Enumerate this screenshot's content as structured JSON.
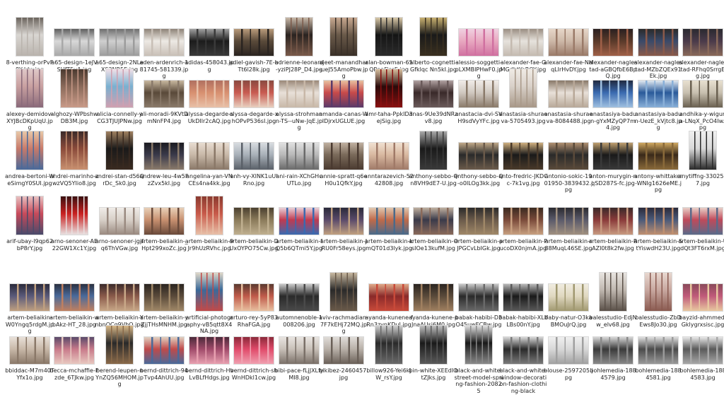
{
  "files": [
    {
      "name": "8-verthing-orPvF8Y-Idw.jpg",
      "shape": "p",
      "colors": [
        "#d9d6d2",
        "#b9b3ad",
        "#6a635c"
      ]
    },
    {
      "name": "a65-design-1eJVSUfT5yA.jpg",
      "shape": "l",
      "colors": [
        "#d8d8d8",
        "#a8a8a8",
        "#5e5e5e"
      ]
    },
    {
      "name": "a65-design-2NLeXS3NR5E.jpg",
      "shape": "l",
      "colors": [
        "#cfcfcf",
        "#9c9c9c",
        "#6e6e6e"
      ]
    },
    {
      "name": "aden-ardenrich-181745-581339.jpg",
      "shape": "l",
      "colors": [
        "#ede9e4",
        "#c8bfb6",
        "#8e8378"
      ]
    },
    {
      "name": "adidas-458043.jpg",
      "shape": "l",
      "colors": [
        "#1c1c1c",
        "#3a3a3a",
        "#a0a0a0"
      ]
    },
    {
      "name": "adiel-gavish-7E-bTt6l28k.jpg",
      "shape": "l",
      "colors": [
        "#5a4a3a",
        "#2a2420",
        "#b89a7a"
      ]
    },
    {
      "name": "adrienne-leonard-yziPJ28P_D4.jpg",
      "shape": "p",
      "colors": [
        "#2a2320",
        "#7a5a4a",
        "#c8b8a8"
      ]
    },
    {
      "name": "ajeet-manandhar-ueJ55AmoPbw.jpg",
      "shape": "p",
      "colors": [
        "#6a5a4a",
        "#3a3028",
        "#c8a890"
      ]
    },
    {
      "name": "alan-bowman-65QPpnFissE.jpg",
      "shape": "p",
      "colors": [
        "#141414",
        "#2c2c2c",
        "#d8c8a8"
      ]
    },
    {
      "name": "alberto-cognetti-Gfklqc Nn5kI.jpg",
      "shape": "p",
      "colors": [
        "#1a1a1a",
        "#3a3020",
        "#c8b070"
      ]
    },
    {
      "name": "alessio-soggetti-pLXMBIPHwF0.jpg",
      "shape": "l",
      "colors": [
        "#e8a8c0",
        "#d070a0",
        "#f0d0e0"
      ]
    },
    {
      "name": "alexander-fae-GMGdhtYeROY.jpg",
      "shape": "l",
      "colors": [
        "#e6e2dc",
        "#c4bab0",
        "#9a8e82"
      ]
    },
    {
      "name": "alexander-fae-NHqLIrHvDY.jpg",
      "shape": "l",
      "colors": [
        "#cdb8a8",
        "#9a7a68",
        "#e6d6c8"
      ]
    },
    {
      "name": "alexander-naglestad-aGBQfbE6BpQ.jpg",
      "shape": "l",
      "colors": [
        "#5a3a2a",
        "#a06048",
        "#2a2020"
      ]
    },
    {
      "name": "alexander-naglestad-MZbZQEx91Ek.jpg",
      "shape": "l",
      "colors": [
        "#3a4a6a",
        "#8a5a4a",
        "#2a2a2a"
      ]
    },
    {
      "name": "alexander-naglestad-RFhq0SrrgEg.jpg",
      "shape": "l",
      "colors": [
        "#4a3a4a",
        "#8a6a5a",
        "#2a2a30"
      ]
    },
    {
      "name": "alexey-demidov-XYJBcDKpUqU.jpg",
      "shape": "p",
      "colors": [
        "#c8a0a0",
        "#8a6a7a",
        "#e0c8c8"
      ]
    },
    {
      "name": "alghozy-WPbshwDB3M.jpg",
      "shape": "p",
      "colors": [
        "#8a6a5a",
        "#c89a88",
        "#4a3a30"
      ]
    },
    {
      "name": "alicia-connelly-yCG3TJUJPNw.jpg",
      "shape": "p",
      "colors": [
        "#7ab0d0",
        "#d0a0b0",
        "#f0e0e8"
      ]
    },
    {
      "name": "ali-moradi-9KVtDmNnFP4.jpg",
      "shape": "l",
      "colors": [
        "#5a4a3a",
        "#8a7a6a",
        "#c8b8a0"
      ]
    },
    {
      "name": "alyssa-degarde-sUkDIlr2cAQ.jpg",
      "shape": "l",
      "colors": [
        "#d89070",
        "#e8c0a8",
        "#b07060"
      ]
    },
    {
      "name": "alyssa-degarde-xhOPvP536sI.jpg",
      "shape": "l",
      "colors": [
        "#c85a50",
        "#e8d0c0",
        "#8a4a40"
      ]
    },
    {
      "name": "alyssa-strohmann-TS--uNw-JqE.jpg",
      "shape": "l",
      "colors": [
        "#e8e0d8",
        "#c8b8a8",
        "#9a8878"
      ]
    },
    {
      "name": "amanda-canas-WIDjrxUGLUE.jpg",
      "shape": "l",
      "colors": [
        "#c84a4a",
        "#5a3a6a",
        "#e8c0a0"
      ]
    },
    {
      "name": "amr-taha-PpkID3ejSig.jpg",
      "shape": "p",
      "colors": [
        "#2a0a0a",
        "#8a1010",
        "#d8c0a0"
      ]
    },
    {
      "name": "anas-9Ue39dNRzv8.jpg",
      "shape": "l",
      "colors": [
        "#3a2a2a",
        "#6a5a5a",
        "#b0a0a0"
      ]
    },
    {
      "name": "anastacia-dvi-SVH9sdVyYFc.jpg",
      "shape": "l",
      "colors": [
        "#d0c8c0",
        "#8a7a6a",
        "#f0ece8"
      ]
    },
    {
      "name": "anastasia-shuraeva-5705493.jpg",
      "shape": "p",
      "colors": [
        "#d8d0c8",
        "#a89888",
        "#f0ebe5"
      ]
    },
    {
      "name": "anastasia-shuraeva-8084488.jpg",
      "shape": "l",
      "colors": [
        "#e8e0d8",
        "#b8a898",
        "#887868"
      ]
    },
    {
      "name": "anastasiya-badun-gYxMZyQP7m4.jpg",
      "shape": "l",
      "colors": [
        "#3a6ab0",
        "#a0c0e0",
        "#202a40"
      ]
    },
    {
      "name": "anastasiya-badun-UezE_kVjtc8.jpg",
      "shape": "l",
      "colors": [
        "#2a5a9a",
        "#8ab0d8",
        "#e0e8f0"
      ]
    },
    {
      "name": "andhika-y-wiguna-LNqX_PcO4Iw.jpg",
      "shape": "l",
      "colors": [
        "#c8c0b0",
        "#6a6050",
        "#e8e0d0"
      ]
    },
    {
      "name": "andrea-bertoni-WeSimgY0SUI.jpg",
      "shape": "p",
      "colors": [
        "#c87a6a",
        "#4a6a9a",
        "#e8c8a8"
      ]
    },
    {
      "name": "andrei-marinho-zwzVQ5YIio8.jpg",
      "shape": "p",
      "colors": [
        "#8a4a3a",
        "#c89070",
        "#3a2a2a"
      ]
    },
    {
      "name": "andrei-stan-d56QrDc_Sk0.jpg",
      "shape": "p",
      "colors": [
        "#1a1a1a",
        "#3a2a20",
        "#a08060"
      ]
    },
    {
      "name": "andrew-leu-4w5FzZvx5kI.jpg",
      "shape": "l",
      "colors": [
        "#3a3a4a",
        "#8a7a6a",
        "#1a1a20"
      ]
    },
    {
      "name": "angelina-yan-VNCEs4na4kk.jpg",
      "shape": "l",
      "colors": [
        "#c8b8a8",
        "#8a7868",
        "#e8dcd0"
      ]
    },
    {
      "name": "anh-vy-XINK1uUlRno.jpg",
      "shape": "l",
      "colors": [
        "#a8b0b8",
        "#5a6068",
        "#d8dce0"
      ]
    },
    {
      "name": "ani-rain-XChGHcUTLo.jpg",
      "shape": "l",
      "colors": [
        "#b8b8b8",
        "#6a6a6a",
        "#e0e0e0"
      ]
    },
    {
      "name": "annie-spratt-q6eH0u1QfkY.jpg",
      "shape": "l",
      "colors": [
        "#7a6a5a",
        "#4a3a30",
        "#c0b0a0"
      ]
    },
    {
      "name": "anntarazevich-5242808.jpg",
      "shape": "l",
      "colors": [
        "#d8b8a0",
        "#a07a68",
        "#f0e0d0"
      ]
    },
    {
      "name": "anthony-sebbo-Qn8VH9dE7-U.jpg",
      "shape": "p",
      "colors": [
        "#1a1a1a",
        "#3a3a3a",
        "#a8a8a8"
      ]
    },
    {
      "name": "anthony-sebbo-Q-o0ILOg3kk.jpg",
      "shape": "l",
      "colors": [
        "#2a2a2a",
        "#6a5a4a",
        "#c0a888"
      ]
    },
    {
      "name": "anto-fredric-JKDCc-7k1vg.jpg",
      "shape": "l",
      "colors": [
        "#1a1a1a",
        "#4a3a2a",
        "#d0b080"
      ]
    },
    {
      "name": "antonio-sokic-1901950-3839432.jpg",
      "shape": "l",
      "colors": [
        "#2a2a2a",
        "#5a4a3a",
        "#b09070"
      ]
    },
    {
      "name": "anton-murygin-nqSD287S-fc.jpg",
      "shape": "l",
      "colors": [
        "#1a1a1a",
        "#3a3a3a",
        "#c0a070"
      ]
    },
    {
      "name": "antony-whittaker-WNIg1626eME.jpg",
      "shape": "l",
      "colors": [
        "#3a2a1a",
        "#8a6a3a",
        "#d0a860"
      ]
    },
    {
      "name": "anytiffng-3302537.jpg",
      "shape": "p",
      "colors": [
        "#d8d8d8",
        "#2a2a2a",
        "#f0f0f0"
      ]
    },
    {
      "name": "arif-ubay-l9qp62bP8rY.jpg",
      "shape": "p",
      "colors": [
        "#c84a5a",
        "#4a4a6a",
        "#e8c0c0"
      ]
    },
    {
      "name": "arno-senoner-AE22GW1Xc1Y.jpg",
      "shape": "p",
      "colors": [
        "#c82020",
        "#e8e0e0",
        "#3a1010"
      ]
    },
    {
      "name": "arno-senoner-jgjfq6ThVGw.jpg",
      "shape": "l",
      "colors": [
        "#d8d0c8",
        "#9a8a80",
        "#f0ece8"
      ]
    },
    {
      "name": "artem-beliaikin-_Hpt299xoZc.jpg",
      "shape": "l",
      "colors": [
        "#c89070",
        "#6a4a3a",
        "#e8d0b8"
      ]
    },
    {
      "name": "artem-beliaikin-9Jr9hUzRVhc.jpg",
      "shape": "p",
      "colors": [
        "#c85a4a",
        "#e8c0a8",
        "#8a3a30"
      ]
    },
    {
      "name": "artem-beliaikin-DUxOYPO75Cw.jpg",
      "shape": "l",
      "colors": [
        "#8a7a5a",
        "#c0b090",
        "#4a4030"
      ]
    },
    {
      "name": "artem-beliaikin-fQ5b6QTmi5Y.jpg",
      "shape": "l",
      "colors": [
        "#c03a50",
        "#3a6ab0",
        "#e8d0d8"
      ]
    },
    {
      "name": "artem-beliaikin-JRU0Fr58eys.jpg",
      "shape": "l",
      "colors": [
        "#5a4a6a",
        "#c0a080",
        "#2a2a3a"
      ]
    },
    {
      "name": "artem-beliaikin-kmQT01d3lyk.jpg",
      "shape": "l",
      "colors": [
        "#c06a4a",
        "#4a6a8a",
        "#e0c8b0"
      ]
    },
    {
      "name": "artem-beliaikin-OsIOe13kufM.jpg",
      "shape": "l",
      "colors": [
        "#3a3a4a",
        "#8a6a5a",
        "#c0b0a0"
      ]
    },
    {
      "name": "artem-beliaikin-pJPGCvLbIGk.jpg",
      "shape": "l",
      "colors": [
        "#6a5a4a",
        "#a08868",
        "#2a2a2a"
      ]
    },
    {
      "name": "artem-beliaikin-PucoDX0njmA.jpg",
      "shape": "l",
      "colors": [
        "#7a4a3a",
        "#c8a080",
        "#3a2a20"
      ]
    },
    {
      "name": "artem-beliaikin-r88MuqL46SE.jpg",
      "shape": "l",
      "colors": [
        "#5a5a6a",
        "#a09080",
        "#2a2a30"
      ]
    },
    {
      "name": "artem-beliaikin-RAZI0t8k2fw.jpg",
      "shape": "l",
      "colors": [
        "#8a3a3a",
        "#c89a80",
        "#3a2a2a"
      ]
    },
    {
      "name": "artem-beliaikin-StYiswdH23U.jpg",
      "shape": "l",
      "colors": [
        "#4a5a7a",
        "#c09070",
        "#2a2a3a"
      ]
    },
    {
      "name": "artem-beliaikin-UdQt3FT6rxM.jpg",
      "shape": "l",
      "colors": [
        "#c04a5a",
        "#5a6a8a",
        "#e8d0c8"
      ]
    },
    {
      "name": "artem-beliaikin-W0Yngq5rdgM.jpg",
      "shape": "l",
      "colors": [
        "#5a5a7a",
        "#c0a080",
        "#2a2a3a"
      ]
    },
    {
      "name": "artem-beliaikin-wbAkz-HT_28.jpg",
      "shape": "l",
      "colors": [
        "#4a6a9a",
        "#c08060",
        "#2a3040"
      ]
    },
    {
      "name": "artem-beliaikin-YnbnQCg9VhQ.jpg",
      "shape": "l",
      "colors": [
        "#8a5a4a",
        "#c8a888",
        "#3a2a2a"
      ]
    },
    {
      "name": "artem-beliaikin-yZjjTHsMNHM.jpg",
      "shape": "l",
      "colors": [
        "#5a4a3a",
        "#a08868",
        "#2a2420"
      ]
    },
    {
      "name": "artificial-photography-vB5qtt8X4NA.jpg",
      "shape": "p",
      "colors": [
        "#3a6a9a",
        "#c04a4a",
        "#e0d8c8"
      ]
    },
    {
      "name": "arturo-rey-5yP83RhaFGA.jpg",
      "shape": "l",
      "colors": [
        "#c05a4a",
        "#e8c0a0",
        "#5a3a30"
      ]
    },
    {
      "name": "automnenoble-1008206.jpg",
      "shape": "l",
      "colors": [
        "#2a2a2a",
        "#4a4a4a",
        "#c8c8c8"
      ]
    },
    {
      "name": "aviv-rachmadian-7F7kEHj72MQ.jpg",
      "shape": "p",
      "colors": [
        "#2a2a2a",
        "#6a5a4a",
        "#c8b8a0"
      ]
    },
    {
      "name": "ayanda-kunene-fRn3zvnKDuI.jpg",
      "shape": "l",
      "colors": [
        "#8a2a2a",
        "#c84a3a",
        "#e0a888"
      ]
    },
    {
      "name": "ayanda-kunene-pJnaAUsj6M0.jpg",
      "shape": "l",
      "colors": [
        "#5a4a3a",
        "#a08060",
        "#2a2420"
      ]
    },
    {
      "name": "babak-habibi-D3O45uwECBw.jpg",
      "shape": "l",
      "colors": [
        "#2a2a2a",
        "#6a6a6a",
        "#c8c8c8"
      ]
    },
    {
      "name": "babak-habibi-XLlfLBs00nY.jpg",
      "shape": "l",
      "colors": [
        "#1a1a1a",
        "#5a5a5a",
        "#b8b8b8"
      ]
    },
    {
      "name": "baby-natur-O3kaBMOuJrQ.jpg",
      "shape": "l",
      "colors": [
        "#e0d8c0",
        "#a09870",
        "#f0ece0"
      ]
    },
    {
      "name": "balesstudio-EdjNw_elv68.jpg",
      "shape": "p",
      "colors": [
        "#c0b8b0",
        "#5a5048",
        "#e8e4e0"
      ]
    },
    {
      "name": "balesstudio-ZbDEws8Jo30.jpg",
      "shape": "p",
      "colors": [
        "#c8a8a0",
        "#8a5a50",
        "#e8d8d0"
      ]
    },
    {
      "name": "bayzid-ahmmed-Gklygrxsisc.jpg",
      "shape": "l",
      "colors": [
        "#c05a7a",
        "#e8c8a0",
        "#8a4a5a"
      ]
    },
    {
      "name": "bbiddac-M7m40TYfx1o.jpg",
      "shape": "l",
      "colors": [
        "#c8b8a8",
        "#8a7868",
        "#e8e0d8"
      ]
    },
    {
      "name": "becca-mchaffie-Fzde_6TJkw.jpg",
      "shape": "l",
      "colors": [
        "#c87a8a",
        "#e8c8c0",
        "#5a4a6a"
      ]
    },
    {
      "name": "berend-leupen-nYnZQ56MHOM.jpg",
      "shape": "p",
      "colors": [
        "#2a2a2a",
        "#8a6a4a",
        "#d8b888"
      ]
    },
    {
      "name": "bernd-dittrich-94Tvp4AhUU.jpg",
      "shape": "l",
      "colors": [
        "#c04a4a",
        "#4a6a9a",
        "#e0d0c0"
      ]
    },
    {
      "name": "bernd-dittrich-HvLvBLfHdgs.jpg",
      "shape": "l",
      "colors": [
        "#a04a6a",
        "#e8a0b0",
        "#4a2a3a"
      ]
    },
    {
      "name": "bernd-dittrich-shWnHDkl1cw.jpg",
      "shape": "l",
      "colors": [
        "#e04a6a",
        "#f0a0b0",
        "#8a2a3a"
      ]
    },
    {
      "name": "bibi-pace-fLjJXLfyMI8.jpg",
      "shape": "l",
      "colors": [
        "#c8c0b8",
        "#7a7068",
        "#e8e4e0"
      ]
    },
    {
      "name": "bikibez-2460457.jpg",
      "shape": "l",
      "colors": [
        "#b8b0a8",
        "#6a6058",
        "#e0dcd8"
      ]
    },
    {
      "name": "billow926-Yei6kjW_rsY.jpg",
      "shape": "p",
      "colors": [
        "#2a2a2a",
        "#6a6a6a",
        "#d0d0d0"
      ]
    },
    {
      "name": "bin-white-XEEdIOtZJks.jpg",
      "shape": "p",
      "colors": [
        "#1a1a1a",
        "#5a5a5a",
        "#c0c0c0"
      ]
    },
    {
      "name": "black-and-white-street-model-spring-fashion-20825",
      "shape": "p",
      "colors": [
        "#1a1a1a",
        "#8a8a8a",
        "#e0e0e0"
      ]
    },
    {
      "name": "black-and-white-window-decoration-fashion-clothing-black",
      "shape": "l",
      "colors": [
        "#2a2a2a",
        "#7a7a7a",
        "#d8d8d8"
      ]
    },
    {
      "name": "blouse-2597205.jpg",
      "shape": "l",
      "colors": [
        "#d8d8d8",
        "#a0a0a0",
        "#f0f0f0"
      ]
    },
    {
      "name": "bohlemedia-1884579.jpg",
      "shape": "l",
      "colors": [
        "#3a3a3a",
        "#8a8a8a",
        "#d8d8d8"
      ]
    },
    {
      "name": "bohlemedia-1884581.jpg",
      "shape": "l",
      "colors": [
        "#4a4a4a",
        "#9a9a9a",
        "#e0e0e0"
      ]
    },
    {
      "name": "bohlemedia-1884583.jpg",
      "shape": "l",
      "colors": [
        "#5a5a5a",
        "#a8a8a8",
        "#e8e8e8"
      ]
    }
  ]
}
